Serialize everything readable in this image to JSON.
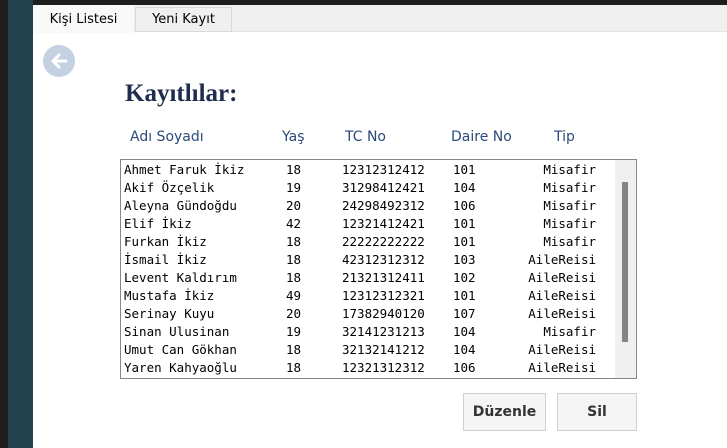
{
  "tabs": [
    {
      "label": "Kişi Listesi"
    },
    {
      "label": "Yeni Kayıt"
    }
  ],
  "title": "Kayıtlılar:",
  "columns": [
    "Adı Soyadı",
    "Yaş",
    "TC No",
    "Daire No",
    "Tip"
  ],
  "rows": [
    [
      "Ahmet Faruk İkiz",
      "18",
      "12312312412",
      "101",
      "Misafir"
    ],
    [
      "Akif Özçelik",
      "19",
      "31298412421",
      "104",
      "Misafir"
    ],
    [
      "Aleyna Gündoğdu",
      "20",
      "24298492312",
      "106",
      "Misafir"
    ],
    [
      "Elif İkiz",
      "42",
      "12321412421",
      "101",
      "Misafir"
    ],
    [
      "Furkan İkiz",
      "18",
      "22222222222",
      "101",
      "Misafir"
    ],
    [
      "İsmail İkiz",
      "18",
      "42312312312",
      "103",
      "AileReisi"
    ],
    [
      "Levent Kaldırım",
      "18",
      "21321312411",
      "102",
      "AileReisi"
    ],
    [
      "Mustafa İkiz",
      "49",
      "12312312321",
      "101",
      "AileReisi"
    ],
    [
      "Serinay Kuyu",
      "20",
      "17382940120",
      "107",
      "AileReisi"
    ],
    [
      "Sinan Ulusinan",
      "19",
      "32141231213",
      "104",
      "Misafir"
    ],
    [
      "Umut Can Gökhan",
      "18",
      "32132141212",
      "104",
      "AileReisi"
    ],
    [
      "Yaren Kahyaoğlu",
      "18",
      "12321312312",
      "106",
      "AileReisi"
    ]
  ],
  "buttons": {
    "edit": "Düzenle",
    "delete": "Sil"
  }
}
